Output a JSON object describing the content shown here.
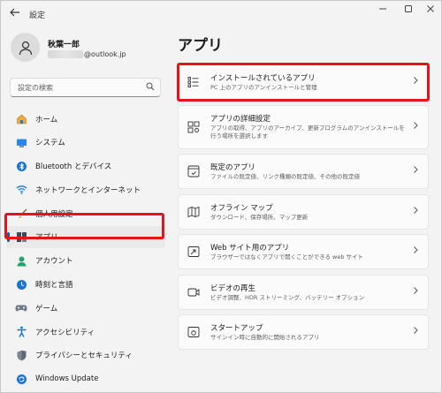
{
  "window": {
    "title": "設定"
  },
  "user": {
    "name": "秋葉一郎",
    "email_domain": "@outlook.jp"
  },
  "search": {
    "placeholder": "設定の検索"
  },
  "nav": {
    "items": [
      {
        "label": "ホーム",
        "icon": "home-icon"
      },
      {
        "label": "システム",
        "icon": "system-icon"
      },
      {
        "label": "Bluetooth とデバイス",
        "icon": "bluetooth-icon"
      },
      {
        "label": "ネットワークとインターネット",
        "icon": "wifi-icon"
      },
      {
        "label": "個人用設定",
        "icon": "brush-icon"
      },
      {
        "label": "アプリ",
        "icon": "apps-icon"
      },
      {
        "label": "アカウント",
        "icon": "account-icon"
      },
      {
        "label": "時刻と言語",
        "icon": "time-language-icon"
      },
      {
        "label": "ゲーム",
        "icon": "gamepad-icon"
      },
      {
        "label": "アクセシビリティ",
        "icon": "accessibility-icon"
      },
      {
        "label": "プライバシーとセキュリティ",
        "icon": "shield-icon"
      },
      {
        "label": "Windows Update",
        "icon": "update-icon"
      }
    ],
    "selected_index": 5
  },
  "main": {
    "title": "アプリ",
    "cards": [
      {
        "title": "インストールされているアプリ",
        "desc": "PC 上のアプリのアンインストールと管理",
        "icon": "installed-apps-icon"
      },
      {
        "title": "アプリの詳細設定",
        "desc": "アプリの取得、アプリのアーカイブ、更新プログラムのアンインストールを行う場所を選択します",
        "icon": "advanced-app-settings-icon"
      },
      {
        "title": "既定のアプリ",
        "desc": "ファイルの既定値、リンク種類の既定値、その他の既定値",
        "icon": "default-apps-icon"
      },
      {
        "title": "オフライン マップ",
        "desc": "ダウンロード、保存場所、マップ更新",
        "icon": "offline-maps-icon"
      },
      {
        "title": "Web サイト用のアプリ",
        "desc": "ブラウザーではなくアプリで開くことができる web サイト",
        "icon": "web-apps-icon"
      },
      {
        "title": "ビデオの再生",
        "desc": "ビデオ調整、HDR ストリーミング、バッテリー オプション",
        "icon": "video-playback-icon"
      },
      {
        "title": "スタートアップ",
        "desc": "サインイン時に自動的に開始されるアプリ",
        "icon": "startup-icon"
      }
    ]
  },
  "colors": {
    "accent": "#005fb8",
    "highlight": "#e8121b"
  }
}
